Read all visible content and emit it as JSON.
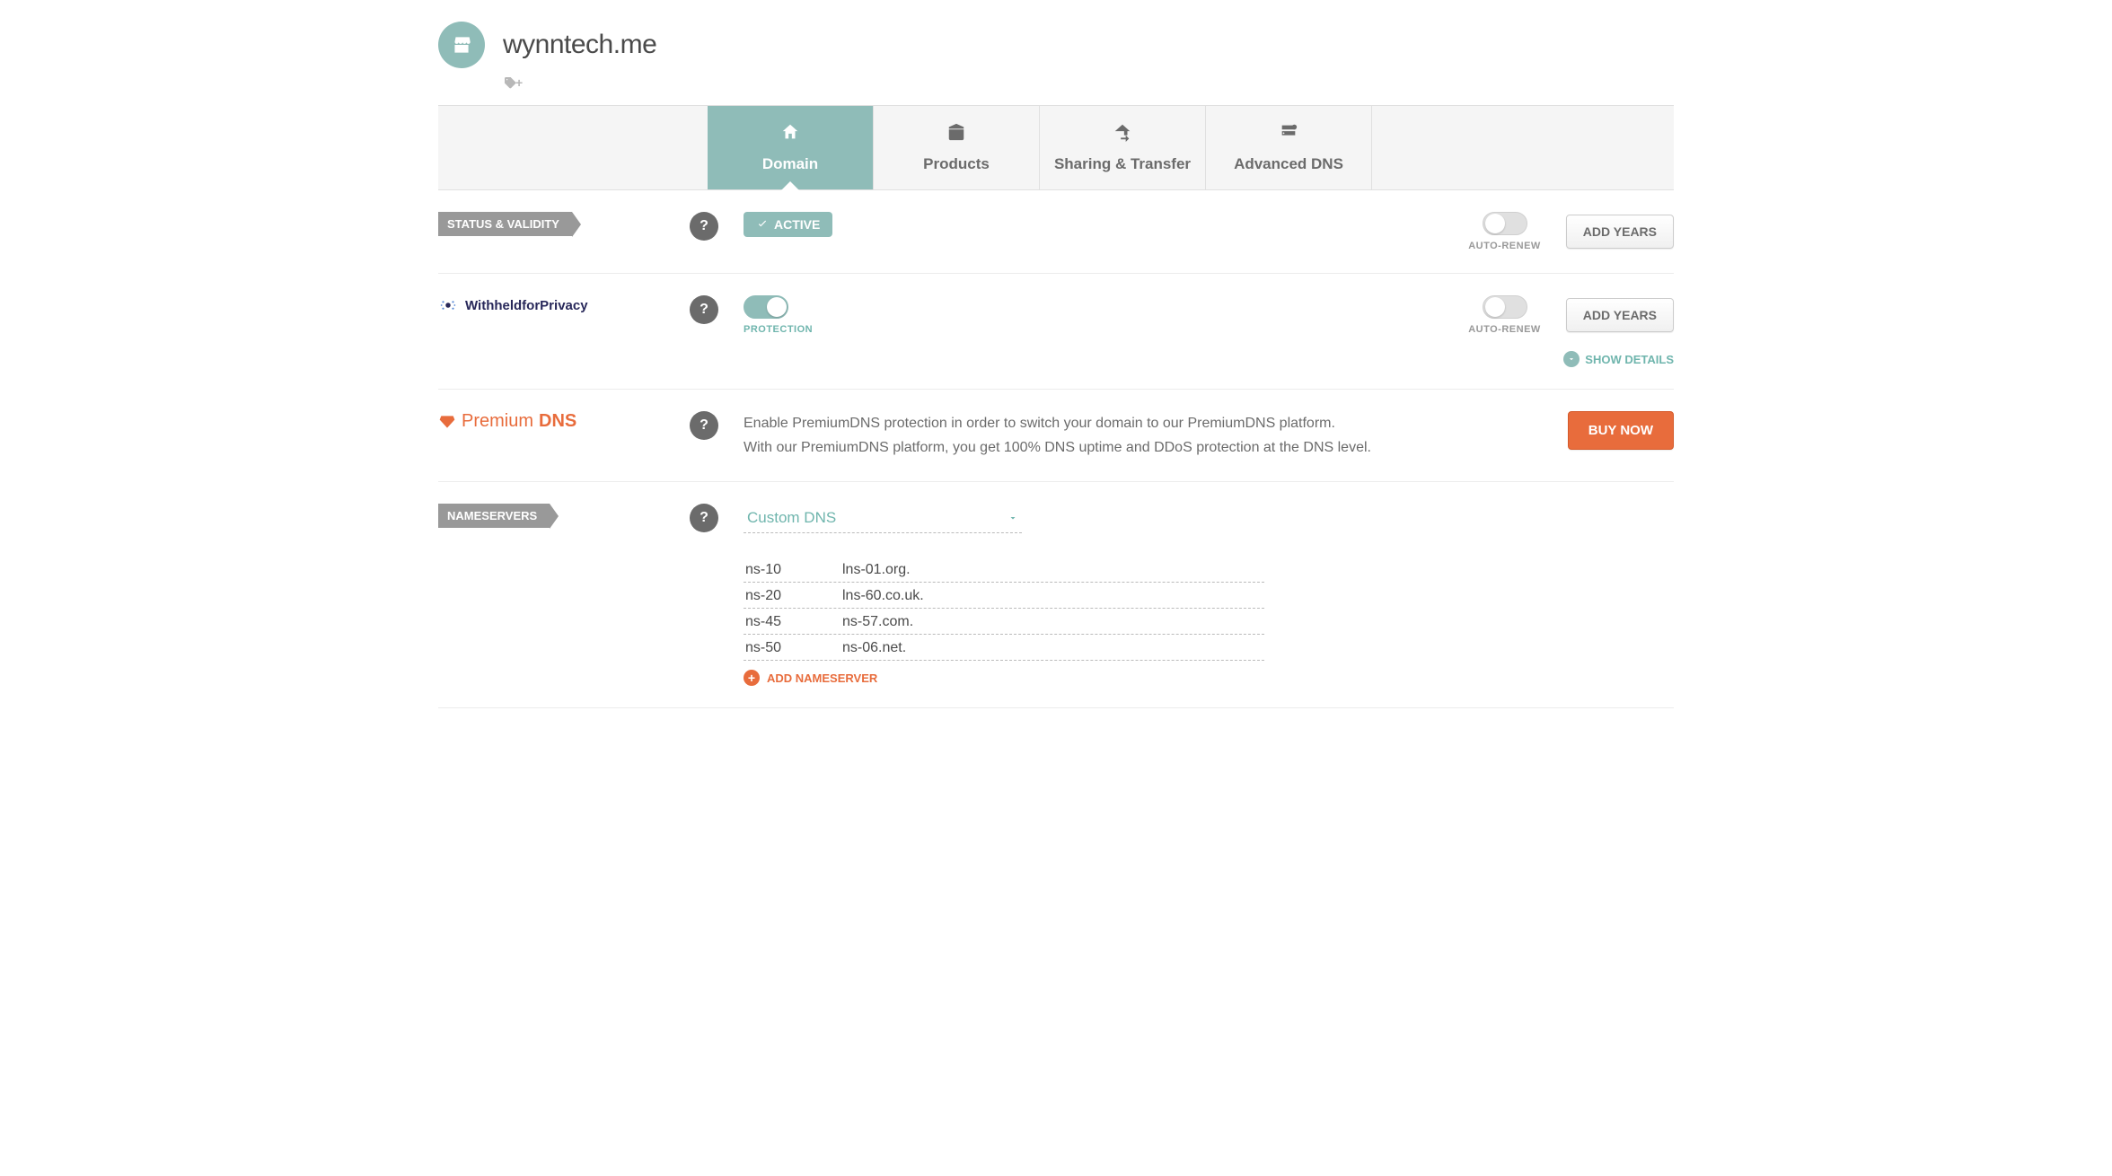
{
  "header": {
    "domain_name": "wynntech.me"
  },
  "tabs": [
    {
      "label": "Domain",
      "active": true
    },
    {
      "label": "Products",
      "active": false
    },
    {
      "label": "Sharing & Transfer",
      "active": false
    },
    {
      "label": "Advanced DNS",
      "active": false
    }
  ],
  "status": {
    "section_label": "STATUS & VALIDITY",
    "badge": "ACTIVE",
    "auto_renew_label": "AUTO-RENEW",
    "add_years_label": "ADD YEARS"
  },
  "privacy": {
    "brand": "WithheldforPrivacy",
    "protection_label": "PROTECTION",
    "auto_renew_label": "AUTO-RENEW",
    "add_years_label": "ADD YEARS",
    "show_details_label": "SHOW DETAILS"
  },
  "premium": {
    "brand_part1": "Premium",
    "brand_part2": "DNS",
    "desc_line1": "Enable PremiumDNS protection in order to switch your domain to our PremiumDNS platform.",
    "desc_line2": "With our PremiumDNS platform, you get 100% DNS uptime and DDoS protection at the DNS level.",
    "buy_now_label": "BUY NOW"
  },
  "nameservers": {
    "section_label": "NAMESERVERS",
    "select_value": "Custom DNS",
    "rows": [
      {
        "p1": "ns-10",
        "p2": "lns-01.org."
      },
      {
        "p1": "ns-20",
        "p2": "lns-60.co.uk."
      },
      {
        "p1": "ns-45",
        "p2": "ns-57.com."
      },
      {
        "p1": "ns-50",
        "p2": "ns-06.net."
      }
    ],
    "add_label": "ADD NAMESERVER"
  }
}
